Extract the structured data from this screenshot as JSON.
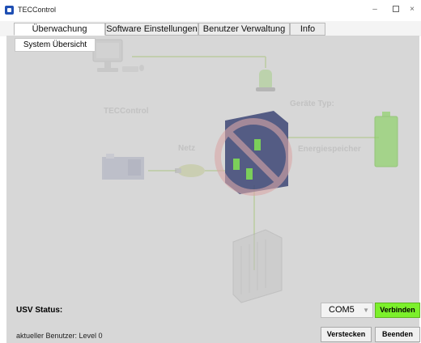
{
  "window": {
    "title": "TECControl",
    "min_glyph": "–",
    "close_glyph": "×"
  },
  "tabs": [
    {
      "label": "Überwachung",
      "active": true
    },
    {
      "label": "Software Einstellungen",
      "active": false
    },
    {
      "label": "Benutzer Verwaltung",
      "active": false
    },
    {
      "label": "Info",
      "active": false
    }
  ],
  "subtabs": [
    {
      "label": "System Übersicht",
      "active": true
    }
  ],
  "diagram": {
    "labels": {
      "teccontrol": "TECControl",
      "netz": "Netz",
      "geraete_typ": "Geräte Typ:",
      "energiespeicher": "Energiespeicher"
    },
    "colors": {
      "line": "#9fc470",
      "battery": "#7ccb54",
      "warning_red": "#d98a8a",
      "usv_box": "#3a4673"
    }
  },
  "status": {
    "usv_label": "USV Status:",
    "user_label": "aktueller Benutzer: Level 0"
  },
  "controls": {
    "com_port": "COM5",
    "connect_label": "Verbinden",
    "hide_label": "Verstecken",
    "exit_label": "Beenden",
    "connect_color": "#7cf02b"
  }
}
